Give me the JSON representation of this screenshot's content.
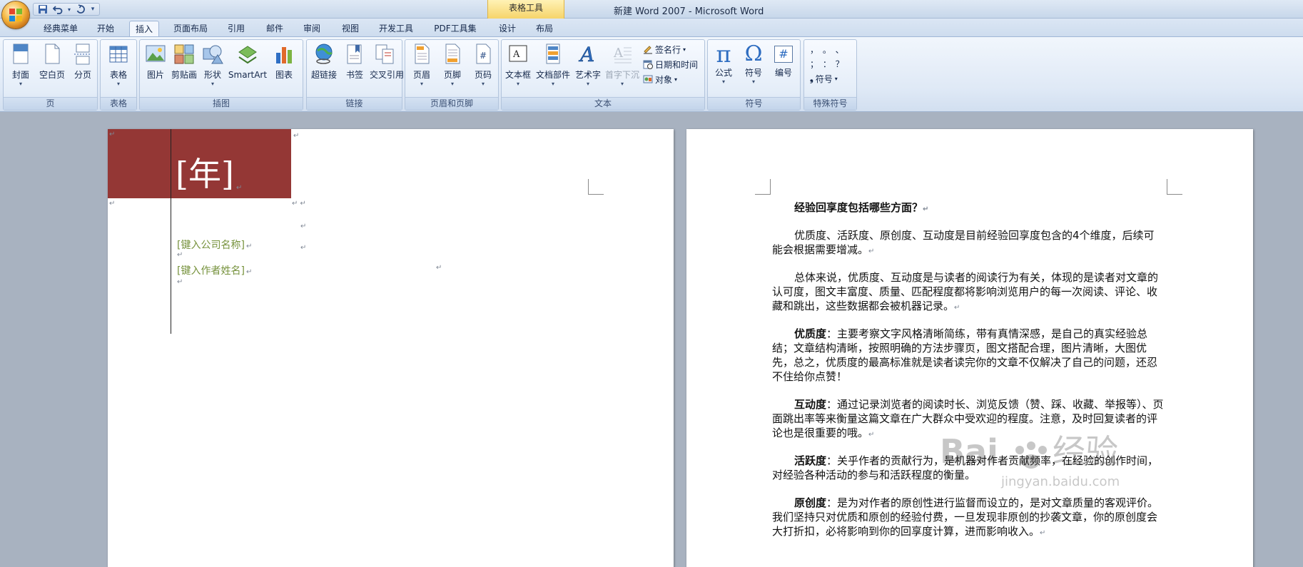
{
  "title_bar": {
    "window_title": "新建 Word 2007 - Microsoft Word",
    "context_tool": "表格工具"
  },
  "quick_access": [
    {
      "icon": "save-icon"
    },
    {
      "icon": "undo-icon"
    },
    {
      "icon": "redo-icon"
    },
    {
      "icon": "customize-dropdown-icon"
    }
  ],
  "tabs": {
    "classic": "经典菜单",
    "home": "开始",
    "insert": "插入",
    "layout": "页面布局",
    "references": "引用",
    "mailings": "邮件",
    "review": "审阅",
    "view": "视图",
    "developer": "开发工具",
    "pdf": "PDF工具集",
    "design": "设计",
    "table_layout": "布局",
    "active": "insert"
  },
  "ribbon": {
    "groups": {
      "pages": "页",
      "tables": "表格",
      "illustrations": "插图",
      "links": "链接",
      "header_footer": "页眉和页脚",
      "text": "文本",
      "symbols": "符号",
      "special_symbols": "特殊符号"
    },
    "buttons": {
      "cover": "封面",
      "blank_page": "空白页",
      "page_break": "分页",
      "table": "表格",
      "picture": "图片",
      "clipart": "剪贴画",
      "shapes": "形状",
      "smartart": "SmartArt",
      "chart": "图表",
      "hyperlink": "超链接",
      "bookmark": "书签",
      "cross_ref": "交叉引用",
      "header": "页眉",
      "footer": "页脚",
      "page_number": "页码",
      "textbox": "文本框",
      "quick_parts": "文档部件",
      "wordart": "艺术字",
      "dropcap": "首字下沉",
      "signature_line": "签名行",
      "date_time": "日期和时间",
      "object": "对象",
      "equation": "公式",
      "symbol": "符号",
      "numbering": "编号",
      "special_symbol": "符号",
      "punct_row1": "，  。  、",
      "punct_row2": "；  ：  ？"
    },
    "symbols": {
      "pi": "π",
      "omega": "Ω",
      "hash": "#"
    }
  },
  "page1": {
    "year_placeholder": "[年]",
    "company_placeholder": "[键入公司名称]",
    "author_placeholder": "[键入作者姓名]",
    "cover_color": "#943735",
    "placeholder_color": "#76923c"
  },
  "page2": {
    "heading": "经验回享度包括哪些方面？",
    "para1": "优质度、活跃度、原创度、互动度是目前经验回享度包含的4个维度，后续可能会根据需要增减。",
    "para2": "总体来说，优质度、互动度是与读者的阅读行为有关，体现的是读者对文章的认可度，图文丰富度、质量、匹配程度都将影响浏览用户的每一次阅读、评论、收藏和跳出，这些数据都会被机器记录。",
    "para3_label": "优质度",
    "para3": "：主要考察文字风格清晰简练，带有真情深感，是自己的真实经验总结；文章结构清晰，按照明确的方法步骤页，图文搭配合理，图片清晰，大图优先，总之，优质度的最高标准就是读者读完你的文章不仅解决了自己的问题，还忍不住给你点赞！",
    "para4_label": "互动度",
    "para4": "：通过记录浏览者的阅读时长、浏览反馈（赞、踩、收藏、举报等）、页面跳出率等来衡量这篇文章在广大群众中受欢迎的程度。注意，及时回复读者的评论也是很重要的哦。",
    "para5_label": "活跃度",
    "para5": "：关乎作者的贡献行为，是机器对作者贡献频率，在经验的创作时间，对经验各种活动的参与和活跃程度的衡量。",
    "para6_label": "原创度",
    "para6": "：是为对作者的原创性进行监督而设立的，是对文章质量的客观评价。我们坚持只对优质和原创的经验付费，一旦发现非原创的抄袭文章，你的原创度会大打折扣，必将影响到你的回享度计算，进而影响收入。"
  },
  "watermark": {
    "brand_left": "Bai",
    "brand_right": "经验",
    "url": "jingyan.baidu.com"
  }
}
